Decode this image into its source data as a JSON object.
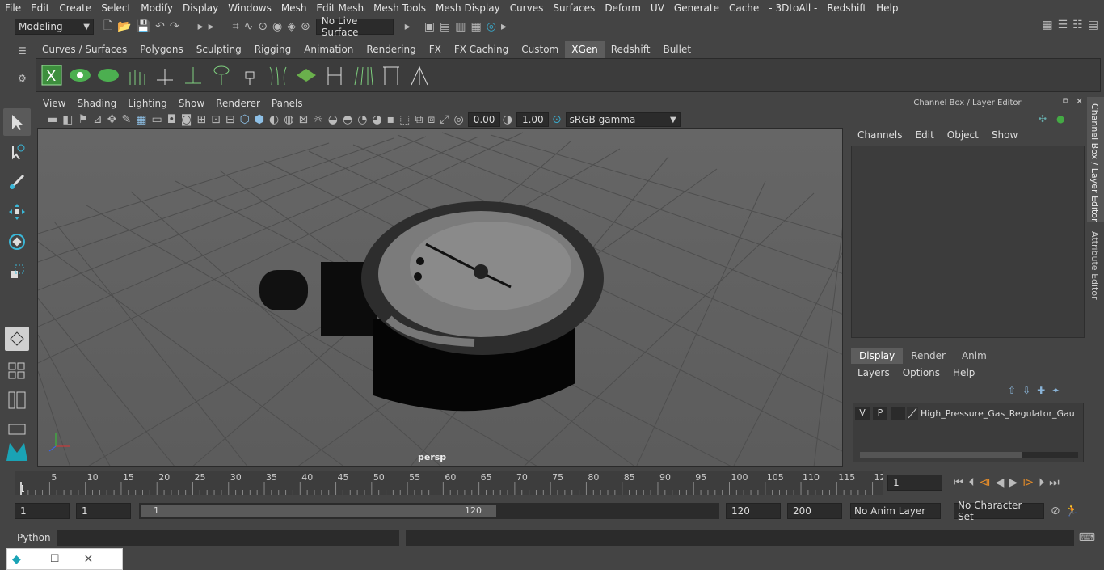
{
  "menu": [
    "File",
    "Edit",
    "Create",
    "Select",
    "Modify",
    "Display",
    "Windows",
    "Mesh",
    "Edit Mesh",
    "Mesh Tools",
    "Mesh Display",
    "Curves",
    "Surfaces",
    "Deform",
    "UV",
    "Generate",
    "Cache",
    "- 3DtoAll -",
    "Redshift",
    "Help"
  ],
  "status": {
    "mode": "Modeling",
    "live_surface": "No Live Surface"
  },
  "shelf_tabs": [
    "Curves / Surfaces",
    "Polygons",
    "Sculpting",
    "Rigging",
    "Animation",
    "Rendering",
    "FX",
    "FX Caching",
    "Custom",
    "XGen",
    "Redshift",
    "Bullet"
  ],
  "active_shelf_tab": "XGen",
  "viewport": {
    "menu": [
      "View",
      "Shading",
      "Lighting",
      "Show",
      "Renderer",
      "Panels"
    ],
    "exposure": "0.00",
    "gamma": "1.00",
    "color_space": "sRGB gamma",
    "camera_label": "persp"
  },
  "channel_box": {
    "title": "Channel Box / Layer Editor",
    "menu": [
      "Channels",
      "Edit",
      "Object",
      "Show"
    ],
    "tabs": [
      "Display",
      "Render",
      "Anim"
    ],
    "active_tab": "Display",
    "layer_menu": [
      "Layers",
      "Options",
      "Help"
    ],
    "layer": {
      "v": "V",
      "p": "P",
      "name": "High_Pressure_Gas_Regulator_Gauge"
    }
  },
  "side_tabs": [
    "Channel Box / Layer Editor",
    "Attribute Editor"
  ],
  "timeline": {
    "ticks": [
      "5",
      "10",
      "15",
      "20",
      "25",
      "30",
      "35",
      "40",
      "45",
      "50",
      "55",
      "60",
      "65",
      "70",
      "75",
      "80",
      "85",
      "90",
      "95",
      "100",
      "105",
      "110",
      "115",
      "12"
    ],
    "start_label": "1",
    "current_frame": "1"
  },
  "range": {
    "start": "1",
    "start2": "1",
    "slider_start": "1",
    "slider_end": "120",
    "end": "120",
    "end2": "200",
    "anim_layer": "No Anim Layer",
    "char_set": "No Character Set"
  },
  "cmdline": {
    "label": "Python"
  }
}
